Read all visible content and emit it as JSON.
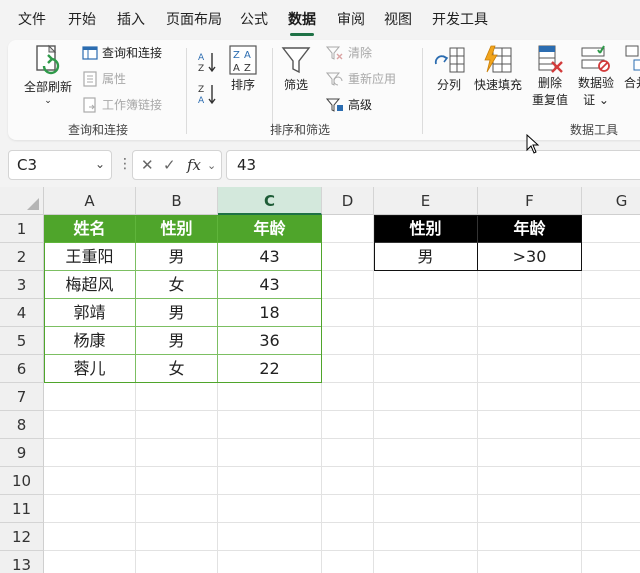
{
  "menu": {
    "tabs": [
      {
        "label": "文件",
        "active": false
      },
      {
        "label": "开始",
        "active": false
      },
      {
        "label": "插入",
        "active": false
      },
      {
        "label": "页面布局",
        "active": false
      },
      {
        "label": "公式",
        "active": false
      },
      {
        "label": "数据",
        "active": true
      },
      {
        "label": "审阅",
        "active": false
      },
      {
        "label": "视图",
        "active": false
      },
      {
        "label": "开发工具",
        "active": false
      }
    ]
  },
  "ribbon": {
    "refresh_all": "全部刷新",
    "queries_connections": "查询和连接",
    "properties": "属性",
    "workbook_links": "工作簿链接",
    "group_queries": "查询和连接",
    "sort_az": "A→Z",
    "sort_za": "Z→A",
    "sort": "排序",
    "filter": "筛选",
    "clear": "清除",
    "reapply": "重新应用",
    "advanced": "高级",
    "group_sort_filter": "排序和筛选",
    "text_to_columns": "分列",
    "flash_fill": "快速填充",
    "remove_duplicates_1": "删除",
    "remove_duplicates_2": "重复值",
    "data_validation_1": "数据验",
    "data_validation_2": "证",
    "consolidate": "合并",
    "group_data_tools": "数据工具",
    "colors": {
      "green": "#1e7145",
      "icon_blue": "#2b6cb0",
      "icon_red": "#d23b3b"
    }
  },
  "formula_bar": {
    "name_box": "C3",
    "formula": "43",
    "fx": "fx"
  },
  "sheet": {
    "columns": [
      "A",
      "B",
      "C",
      "D",
      "E",
      "F",
      "G"
    ],
    "selected_column": "C",
    "rows": [
      "1",
      "2",
      "3",
      "4",
      "5",
      "6",
      "7",
      "8",
      "9",
      "10",
      "11",
      "12",
      "13"
    ],
    "table": {
      "headers": [
        "姓名",
        "性别",
        "年龄"
      ],
      "rows": [
        [
          "王重阳",
          "男",
          "43"
        ],
        [
          "梅超风",
          "女",
          "43"
        ],
        [
          "郭靖",
          "男",
          "18"
        ],
        [
          "杨康",
          "男",
          "36"
        ],
        [
          "蓉儿",
          "女",
          "22"
        ]
      ],
      "header_color": "#4fa52b"
    },
    "criteria": {
      "headers": [
        "性别",
        "年龄"
      ],
      "values": [
        "男",
        ">30"
      ],
      "header_color": "#000000"
    }
  }
}
